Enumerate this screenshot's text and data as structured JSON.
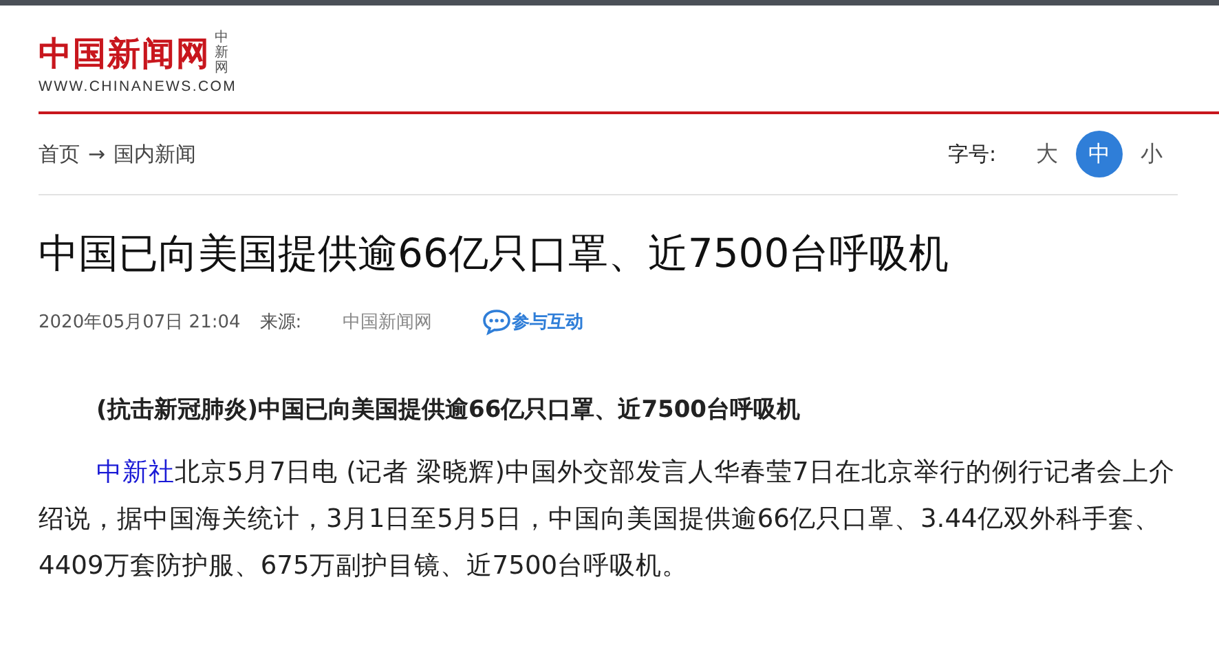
{
  "logo": {
    "name": "中国新闻网",
    "badge": "中新网",
    "url": "WWW.CHINANEWS.COM"
  },
  "breadcrumb": {
    "items": [
      "首页",
      "国内新闻"
    ],
    "separator": "→"
  },
  "font_size": {
    "label": "字号:",
    "options": [
      {
        "label": "大",
        "selected": false
      },
      {
        "label": "中",
        "selected": true
      },
      {
        "label": "小",
        "selected": false
      }
    ]
  },
  "article": {
    "title": "中国已向美国提供逾66亿只口罩、近7500台呼吸机",
    "date": "2020年05月07日 21:04",
    "source_label": "来源:",
    "source": "中国新闻网",
    "interact": "参与互动",
    "lead": "(抗击新冠肺炎)中国已向美国提供逾66亿只口罩、近7500台呼吸机",
    "paragraph": {
      "link": "中新社",
      "text": "北京5月7日电 (记者 梁晓辉)中国外交部发言人华春莹7日在北京举行的例行记者会上介绍说，据中国海关统计，3月1日至5月5日，中国向美国提供逾66亿只口罩、3.44亿双外科手套、4409万套防护服、675万副护目镜、近7500台呼吸机。"
    }
  }
}
